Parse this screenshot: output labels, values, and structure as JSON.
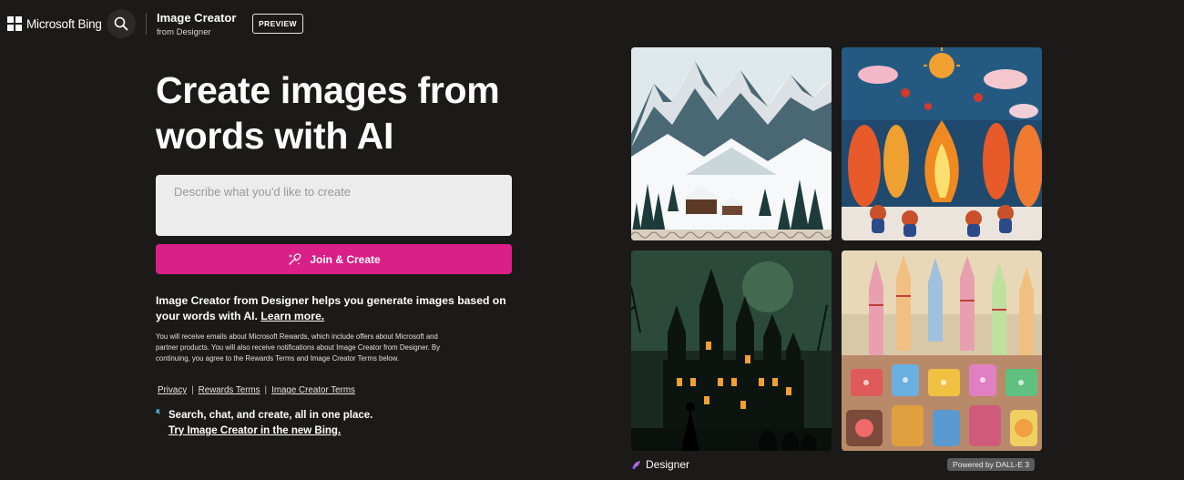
{
  "header": {
    "logo_text": "Microsoft Bing",
    "search_icon": "search-icon",
    "brand_title": "Image Creator",
    "brand_subtitle": "from Designer",
    "preview_label": "PREVIEW"
  },
  "hero": {
    "title": "Create images from words with AI"
  },
  "prompt": {
    "placeholder": "Describe what you'd like to create",
    "value": ""
  },
  "create_button": {
    "label": "Join & Create",
    "icon": "magic-wand-icon",
    "color": "#da1f87"
  },
  "description": {
    "text": "Image Creator from Designer helps you generate images based on your words with AI.",
    "link": "Learn more."
  },
  "fineprint": "You will receive emails about Microsoft Rewards, which include offers about Microsoft and partner products. You will also receive notifications about Image Creator from Designer. By continuing, you agree to the Rewards Terms and Image Creator Terms below.",
  "legal_links": {
    "privacy": "Privacy",
    "rewards_terms": "Rewards Terms",
    "image_creator_terms": "Image Creator Terms",
    "separator": "|"
  },
  "new_bing": {
    "headline": "Search, chat, and create, all in one place.",
    "link": "Try Image Creator in the new Bing."
  },
  "gallery": [
    {
      "name": "snowy-mountain-village"
    },
    {
      "name": "felt-campfire-scene"
    },
    {
      "name": "gothic-castle-night"
    },
    {
      "name": "candy-city"
    }
  ],
  "footer": {
    "designer_label": "Designer",
    "powered_by": "Powered by DALL-E 3"
  },
  "colors": {
    "background": "#1b1a19",
    "accent": "#da1f87",
    "input_bg": "#ececec"
  }
}
